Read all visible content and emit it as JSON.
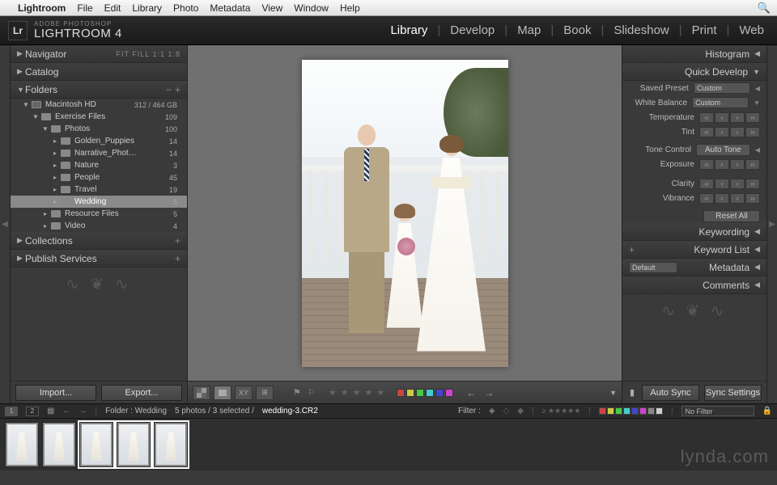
{
  "mac_menu": {
    "app": "Lightroom",
    "items": [
      "File",
      "Edit",
      "Library",
      "Photo",
      "Metadata",
      "View",
      "Window",
      "Help"
    ]
  },
  "header": {
    "subtitle": "ADOBE PHOTOSHOP",
    "title": "LIGHTROOM 4",
    "modules": [
      "Library",
      "Develop",
      "Map",
      "Book",
      "Slideshow",
      "Print",
      "Web"
    ],
    "active_module": "Library"
  },
  "left": {
    "navigator": {
      "label": "Navigator",
      "extras": "FIT  FILL  1:1  1:8"
    },
    "catalog": {
      "label": "Catalog"
    },
    "folders": {
      "label": "Folders",
      "minus": "−",
      "plus": "+"
    },
    "collections": {
      "label": "Collections"
    },
    "publish": {
      "label": "Publish Services"
    },
    "hdd": {
      "name": "Macintosh HD",
      "space": "312 / 464 GB"
    },
    "tree": [
      {
        "name": "Exercise Files",
        "count": "109",
        "indent": 2,
        "expandable": true,
        "open": true
      },
      {
        "name": "Photos",
        "count": "100",
        "indent": 3,
        "expandable": true,
        "open": true
      },
      {
        "name": "Golden_Puppies",
        "count": "14",
        "indent": 4
      },
      {
        "name": "Narrative_Phot…",
        "count": "14",
        "indent": 4
      },
      {
        "name": "Nature",
        "count": "3",
        "indent": 4
      },
      {
        "name": "People",
        "count": "45",
        "indent": 4
      },
      {
        "name": "Travel",
        "count": "19",
        "indent": 4
      },
      {
        "name": "Wedding",
        "count": "5",
        "indent": 4,
        "selected": true
      },
      {
        "name": "Resource Files",
        "count": "5",
        "indent": 3
      },
      {
        "name": "Video",
        "count": "4",
        "indent": 3
      }
    ],
    "import_btn": "Import...",
    "export_btn": "Export..."
  },
  "right": {
    "histogram": "Histogram",
    "quick_develop": "Quick Develop",
    "saved_preset": {
      "label": "Saved Preset",
      "value": "Custom"
    },
    "white_balance": {
      "label": "White Balance",
      "value": "Custom"
    },
    "temperature": "Temperature",
    "tint": "Tint",
    "tone_control": "Tone Control",
    "auto_tone": "Auto Tone",
    "exposure": "Exposure",
    "clarity": "Clarity",
    "vibrance": "Vibrance",
    "reset_all": "Reset All",
    "keywording": "Keywording",
    "keyword_list": "Keyword List",
    "metadata": "Metadata",
    "metadata_preset": "Default",
    "comments": "Comments",
    "auto_sync": "Auto Sync",
    "sync_settings": "Sync Settings"
  },
  "center_toolbar": {
    "swatches": [
      "#c44",
      "#cc4",
      "#4c4",
      "#4cc",
      "#44c",
      "#c4c"
    ],
    "stars": "★ ★ ★ ★ ★"
  },
  "filmstrip_bar": {
    "screens": [
      "1",
      "2"
    ],
    "path": "Folder : Wedding",
    "counts": "5 photos / 3 selected /",
    "current": "wedding-3.CR2",
    "filter_label": "Filter :",
    "nofilter": "No Filter",
    "filter_colors": [
      "#c44",
      "#cc4",
      "#4c4",
      "#4cc",
      "#44c",
      "#c4c",
      "#888",
      "#ccc"
    ]
  },
  "watermark": "lynda.com"
}
